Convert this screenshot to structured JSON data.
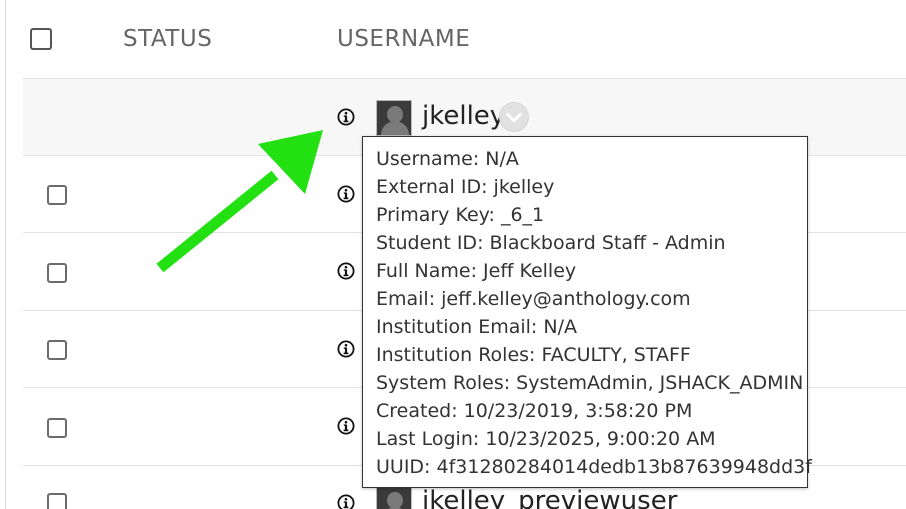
{
  "table": {
    "columns": {
      "status": "STATUS",
      "username": "USERNAME"
    },
    "rows": [
      {
        "username": "jkelley",
        "highlighted": true,
        "has_checkbox": false
      },
      {
        "username": "",
        "highlighted": false,
        "has_checkbox": true
      },
      {
        "username": "",
        "highlighted": false,
        "has_checkbox": true
      },
      {
        "username": "",
        "highlighted": false,
        "has_checkbox": true
      },
      {
        "username": "",
        "highlighted": false,
        "has_checkbox": true
      },
      {
        "username": "jkelley_previewuser",
        "highlighted": false,
        "has_checkbox": true
      }
    ]
  },
  "tooltip": {
    "lines": [
      "Username: N/A",
      "External ID: jkelley",
      "Primary Key: _6_1",
      "Student ID: Blackboard Staff - Admin",
      "Full Name: Jeff Kelley",
      "Email: jeff.kelley@anthology.com",
      "Institution Email: N/A",
      "Institution Roles: FACULTY, STAFF",
      "System Roles: SystemAdmin, JSHACK_ADMIN",
      "Created: 10/23/2019, 3:58:20 PM",
      "Last Login: 10/23/2025, 9:00:20 AM",
      "UUID: 4f31280284014dedb13b87639948dd3f"
    ]
  },
  "icons": {
    "info": "info-circle-icon",
    "chevron": "chevron-down-icon",
    "avatar": "user-avatar-icon",
    "annotation": "green-arrow-icon"
  },
  "colors": {
    "arrow": "#22e012",
    "row_highlight": "#f7f7f7"
  }
}
